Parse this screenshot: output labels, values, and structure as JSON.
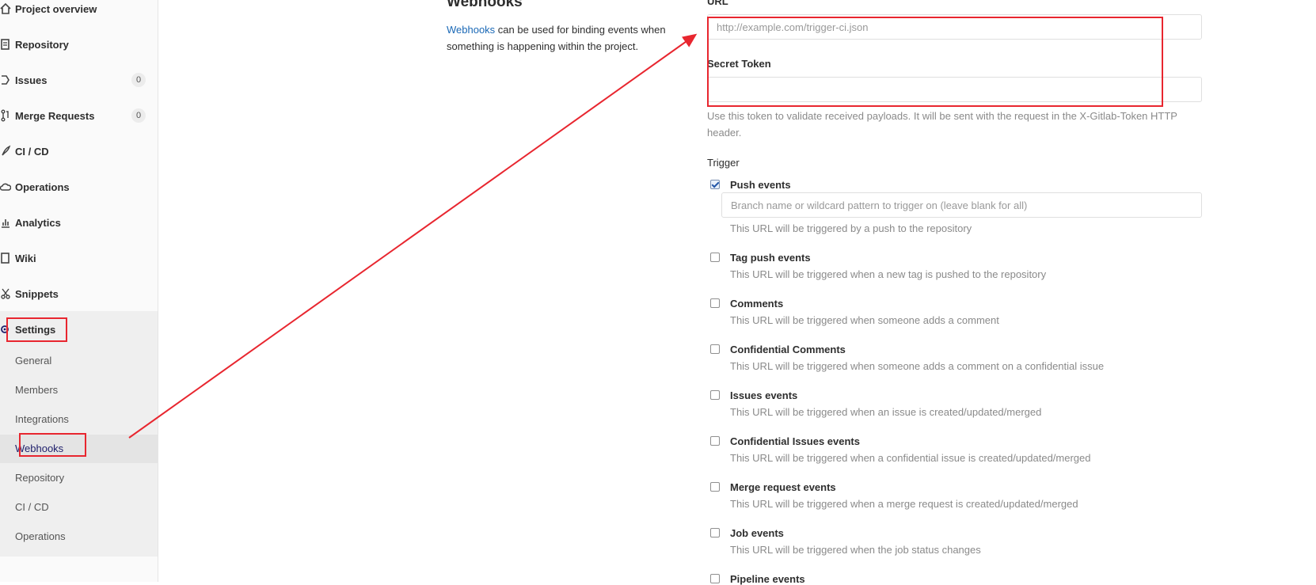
{
  "sidebar": {
    "items": [
      {
        "label": "Project overview",
        "icon": "home-icon"
      },
      {
        "label": "Repository",
        "icon": "book-icon"
      },
      {
        "label": "Issues",
        "icon": "issues-icon",
        "count": "0"
      },
      {
        "label": "Merge Requests",
        "icon": "merge-request-icon",
        "count": "0"
      },
      {
        "label": "CI / CD",
        "icon": "rocket-icon"
      },
      {
        "label": "Operations",
        "icon": "cloud-gear-icon"
      },
      {
        "label": "Analytics",
        "icon": "chart-icon"
      },
      {
        "label": "Wiki",
        "icon": "book-closed-icon"
      },
      {
        "label": "Snippets",
        "icon": "scissors-icon"
      },
      {
        "label": "Settings",
        "icon": "gear-icon"
      }
    ],
    "settings_sub": [
      "General",
      "Members",
      "Integrations",
      "Webhooks",
      "Repository",
      "CI / CD",
      "Operations"
    ],
    "active_sub": "Webhooks"
  },
  "intro": {
    "title": "Webhooks",
    "link_text": "Webhooks",
    "text": " can be used for binding events when something is happening within the project."
  },
  "form": {
    "url_label": "URL",
    "url_placeholder": "http://example.com/trigger-ci.json",
    "token_label": "Secret Token",
    "token_value": "",
    "token_help": "Use this token to validate received payloads. It will be sent with the request in the X-Gitlab-Token HTTP header.",
    "trigger_label": "Trigger",
    "branch_placeholder": "Branch name or wildcard pattern to trigger on (leave blank for all)"
  },
  "events": [
    {
      "title": "Push events",
      "help": "This URL will be triggered by a push to the repository",
      "checked": true
    },
    {
      "title": "Tag push events",
      "help": "This URL will be triggered when a new tag is pushed to the repository",
      "checked": false
    },
    {
      "title": "Comments",
      "help": "This URL will be triggered when someone adds a comment",
      "checked": false
    },
    {
      "title": "Confidential Comments",
      "help": "This URL will be triggered when someone adds a comment on a confidential issue",
      "checked": false
    },
    {
      "title": "Issues events",
      "help": "This URL will be triggered when an issue is created/updated/merged",
      "checked": false
    },
    {
      "title": "Confidential Issues events",
      "help": "This URL will be triggered when a confidential issue is created/updated/merged",
      "checked": false
    },
    {
      "title": "Merge request events",
      "help": "This URL will be triggered when a merge request is created/updated/merged",
      "checked": false
    },
    {
      "title": "Job events",
      "help": "This URL will be triggered when the job status changes",
      "checked": false
    },
    {
      "title": "Pipeline events",
      "help": "",
      "checked": false
    }
  ],
  "annotation_color": "#e8262f"
}
